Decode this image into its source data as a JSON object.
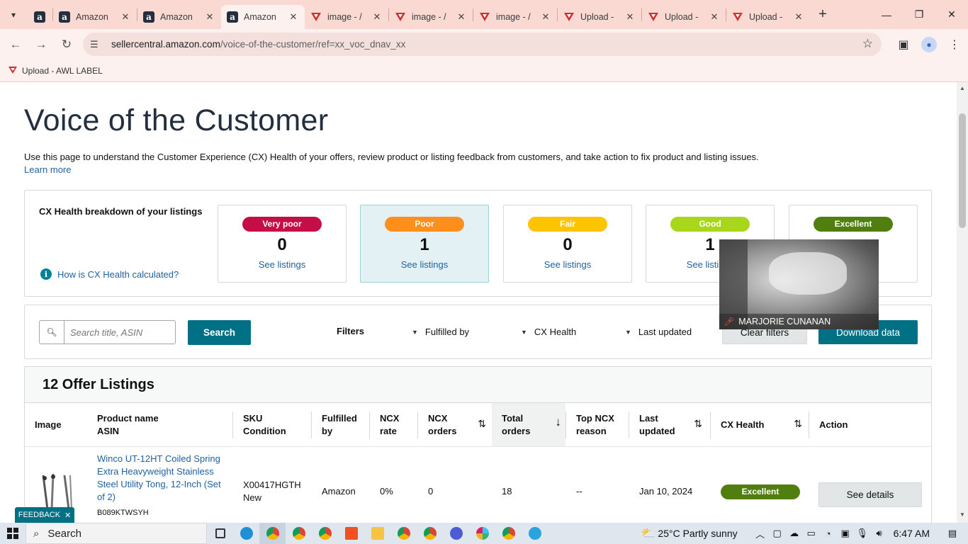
{
  "browser": {
    "tabs": [
      {
        "title": "",
        "favicon": "amazon-favicon",
        "pinned": true
      },
      {
        "title": "Amazon",
        "favicon": "amazon-favicon"
      },
      {
        "title": "Amazon",
        "favicon": "amazon-favicon"
      },
      {
        "title": "Amazon",
        "favicon": "amazon-favicon",
        "active": true
      },
      {
        "title": "image - /",
        "favicon": "triangle-favicon"
      },
      {
        "title": "image - /",
        "favicon": "triangle-favicon"
      },
      {
        "title": "image - /",
        "favicon": "triangle-favicon"
      },
      {
        "title": "Upload - ",
        "favicon": "triangle-favicon"
      },
      {
        "title": "Upload - ",
        "favicon": "triangle-favicon"
      },
      {
        "title": "Upload - ",
        "favicon": "triangle-favicon"
      }
    ],
    "url_host": "sellercentral.amazon.com",
    "url_path": "/voice-of-the-customer/ref=xx_voc_dnav_xx",
    "bookmark": "Upload - AWL LABEL",
    "accent": "#f9d9d2"
  },
  "page": {
    "title": "Voice of the Customer",
    "intro": "Use this page to understand the Customer Experience (CX) Health of your offers, review product or listing feedback from customers, and take action to fix product and listing issues.",
    "learn_more": "Learn more",
    "cx": {
      "label": "CX Health breakdown of your listings",
      "how_link": "How is CX Health calculated?",
      "cards": [
        {
          "label": "Very poor",
          "count": "0",
          "link": "See listings",
          "color": "#c40e45",
          "text_color": "#ffffff"
        },
        {
          "label": "Poor",
          "count": "1",
          "link": "See listings",
          "color": "#ff8f1c",
          "text_color": "#ffffff",
          "selected": true
        },
        {
          "label": "Fair",
          "count": "0",
          "link": "See listings",
          "color": "#ffc400",
          "text_color": "#ffffff"
        },
        {
          "label": "Good",
          "count": "1",
          "link": "See listings",
          "color": "#a8d61b",
          "text_color": "#ffffff"
        },
        {
          "label": "Excellent",
          "count": "",
          "link": "",
          "color": "#507e0f",
          "text_color": "#ffffff"
        }
      ]
    },
    "filters": {
      "search_placeholder": "Search title, ASIN",
      "search_button": "Search",
      "filters_label": "Filters",
      "dropdowns": [
        "Fulfilled by",
        "CX Health",
        "Last updated"
      ],
      "clear": "Clear filters",
      "download": "Download data"
    },
    "listings": {
      "heading": "12 Offer Listings",
      "columns": [
        [
          "Image",
          ""
        ],
        [
          "Product name",
          "ASIN"
        ],
        [
          "SKU",
          "Condition"
        ],
        [
          "Fulfilled",
          "by"
        ],
        [
          "NCX",
          "rate"
        ],
        [
          "NCX",
          "orders"
        ],
        [
          "Total",
          "orders"
        ],
        [
          "Top NCX",
          "reason"
        ],
        [
          "Last",
          "updated"
        ],
        [
          "CX Health",
          ""
        ],
        [
          "Action",
          ""
        ]
      ],
      "rows": [
        {
          "product": "Winco UT-12HT Coiled Spring Extra Heavyweight Stainless Steel Utility Tong, 12-Inch (Set of 2)",
          "asin": "B089KTWSYH",
          "sku": "X00417HGTH",
          "condition": "New",
          "fulfilled_by": "Amazon",
          "ncx_rate": "0%",
          "ncx_orders": "0",
          "total_orders": "18",
          "top_reason": "--",
          "last_updated": "Jan 10, 2024",
          "cx_health": "Excellent",
          "action": "See details"
        }
      ]
    },
    "feedback": "FEEDBACK"
  },
  "video_overlay": {
    "name": "MARJORIE CUNANAN"
  },
  "taskbar": {
    "search": "Search",
    "weather": "25°C  Partly sunny",
    "time": "6:47 AM"
  }
}
